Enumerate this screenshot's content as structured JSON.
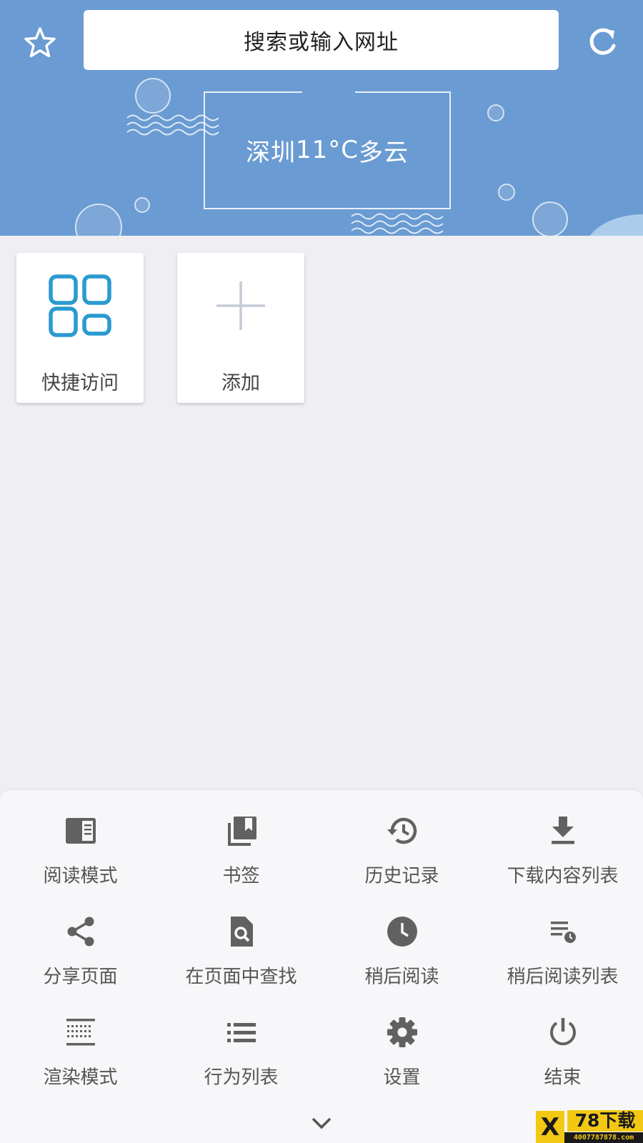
{
  "header": {
    "search_placeholder": "搜索或输入网址",
    "weather": {
      "city": "深圳",
      "temperature": "11°C",
      "condition": "多云"
    },
    "background_color": "#6a9bd2"
  },
  "icons": {
    "star": "star-outline-icon",
    "reload": "reload-icon"
  },
  "tiles": [
    {
      "label": "快捷访问",
      "icon": "grid-icon",
      "icon_color": "#2a9ad0"
    },
    {
      "label": "添加",
      "icon": "plus-icon",
      "icon_color": "#c4cbd6"
    }
  ],
  "menu": {
    "items": [
      {
        "label": "阅读模式",
        "icon": "reader-mode-icon"
      },
      {
        "label": "书签",
        "icon": "bookmarks-icon"
      },
      {
        "label": "历史记录",
        "icon": "history-icon"
      },
      {
        "label": "下载内容列表",
        "icon": "download-icon"
      },
      {
        "label": "分享页面",
        "icon": "share-icon"
      },
      {
        "label": "在页面中查找",
        "icon": "find-in-page-icon"
      },
      {
        "label": "稍后阅读",
        "icon": "clock-icon"
      },
      {
        "label": "稍后阅读列表",
        "icon": "read-later-list-icon"
      },
      {
        "label": "渲染模式",
        "icon": "render-mode-icon"
      },
      {
        "label": "行为列表",
        "icon": "list-icon"
      },
      {
        "label": "设置",
        "icon": "gear-icon"
      },
      {
        "label": "结束",
        "icon": "power-icon"
      }
    ],
    "collapse_icon": "chevron-down-icon",
    "icon_color": "#616161"
  },
  "watermark": {
    "logo": "X",
    "title": "78下载",
    "url": "4007787878.com"
  }
}
